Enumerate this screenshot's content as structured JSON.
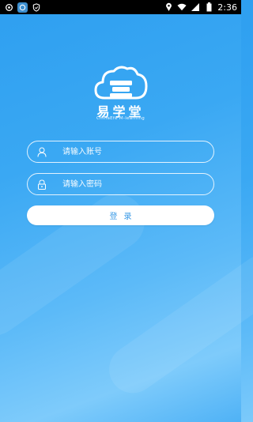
{
  "status_bar": {
    "time": "2:36",
    "icons_left": [
      "settings-icon",
      "app-icon",
      "shield-icon"
    ],
    "icons_right": [
      "location-icon",
      "wifi-icon",
      "signal-icon",
      "battery-icon"
    ]
  },
  "brand": {
    "title": "易学堂",
    "subtitle": "ChinaEfe M-learning",
    "logo_icon": "cloud-book-icon"
  },
  "form": {
    "account_placeholder": "请输入账号",
    "account_value": "",
    "account_icon": "user-icon",
    "password_placeholder": "请输入密码",
    "password_value": "",
    "password_icon": "lock-icon",
    "login_label": "登录"
  },
  "colors": {
    "background_top": "#2e9ff0",
    "background_bottom": "#7ecbfb",
    "login_text": "#3a9ae6"
  }
}
